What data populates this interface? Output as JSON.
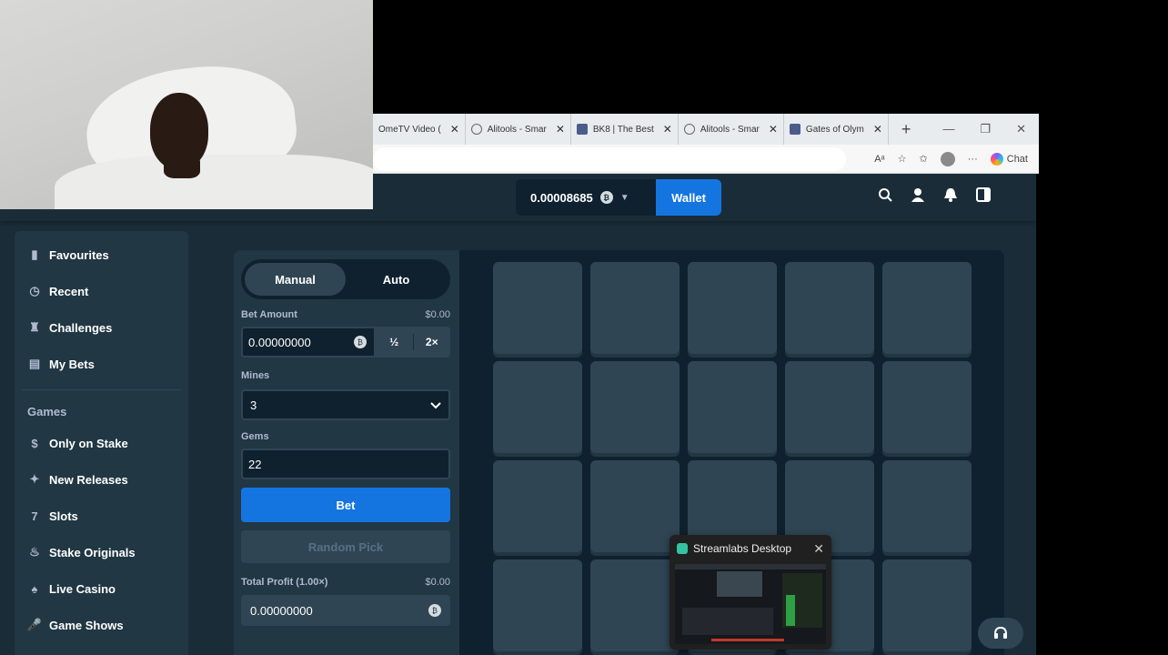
{
  "browser": {
    "tabs": [
      {
        "label": "OmeTV Video (",
        "icon": "globe-icon"
      },
      {
        "label": "Alitools - Smar",
        "icon": "globe-icon"
      },
      {
        "label": "BK8 | The Best",
        "icon": "site-icon"
      },
      {
        "label": "Alitools - Smar",
        "icon": "globe-icon"
      },
      {
        "label": "Gates of Olym",
        "icon": "s-icon"
      }
    ],
    "chat_label": "Chat"
  },
  "topnav": {
    "balance": "0.00008685",
    "wallet_label": "Wallet"
  },
  "sidebar": {
    "items": [
      {
        "label": "Favourites",
        "icon": "bookmark-icon"
      },
      {
        "label": "Recent",
        "icon": "clock-icon"
      },
      {
        "label": "Challenges",
        "icon": "trophy-icon"
      },
      {
        "label": "My Bets",
        "icon": "receipt-icon"
      }
    ],
    "games_heading": "Games",
    "games": [
      {
        "label": "Only on Stake",
        "icon": "stake-icon"
      },
      {
        "label": "New Releases",
        "icon": "sparkle-icon"
      },
      {
        "label": "Slots",
        "icon": "slots-icon"
      },
      {
        "label": "Stake Originals",
        "icon": "flame-icon"
      },
      {
        "label": "Live Casino",
        "icon": "cards-icon"
      },
      {
        "label": "Game Shows",
        "icon": "microphone-icon"
      }
    ]
  },
  "panel": {
    "tab_manual": "Manual",
    "tab_auto": "Auto",
    "bet_amount_label": "Bet Amount",
    "bet_amount_usd": "$0.00",
    "bet_amount_value": "0.00000000",
    "half_label": "½",
    "double_label": "2×",
    "mines_label": "Mines",
    "mines_value": "3",
    "gems_label": "Gems",
    "gems_value": "22",
    "bet_button": "Bet",
    "random_pick": "Random Pick",
    "profit_label": "Total Profit (1.00×)",
    "profit_usd": "$0.00",
    "profit_value": "0.00000000"
  },
  "streamlabs": {
    "title": "Streamlabs Desktop"
  },
  "colors": {
    "accent": "#1475e1",
    "bg": "#1a2c38",
    "panel": "#213743",
    "tile": "#2f4553",
    "dark": "#0f212e"
  }
}
